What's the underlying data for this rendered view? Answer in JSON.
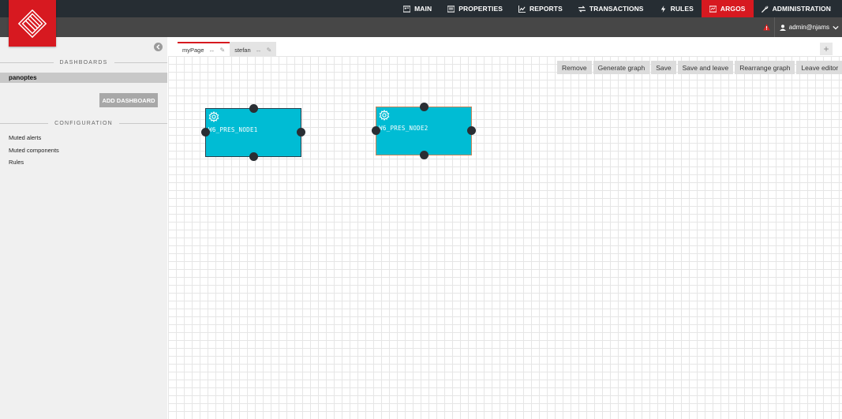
{
  "nav": {
    "items": [
      {
        "icon": "server-icon",
        "label": "MAIN"
      },
      {
        "icon": "list-icon",
        "label": "PROPERTIES"
      },
      {
        "icon": "chart-icon",
        "label": "REPORTS"
      },
      {
        "icon": "arrows-icon",
        "label": "TRANSACTIONS"
      },
      {
        "icon": "bolt-icon",
        "label": "RULES"
      },
      {
        "icon": "dashboard-icon",
        "label": "ARGOS"
      },
      {
        "icon": "wrench-icon",
        "label": "ADMINISTRATION"
      }
    ],
    "active": "ARGOS"
  },
  "user": {
    "name": "admin@njams"
  },
  "sidebar": {
    "dashboards_heading": "DASHBOARDS",
    "dashboards": [
      "panoptes"
    ],
    "add_dashboard_label": "ADD DASHBOARD",
    "configuration_heading": "CONFIGURATION",
    "configuration_items": [
      "Muted alerts",
      "Muted components",
      "Rules"
    ]
  },
  "tabs": [
    {
      "label": "myPage",
      "active": true
    },
    {
      "label": "stefan",
      "active": false
    }
  ],
  "toolbar": {
    "buttons": [
      "Remove",
      "Generate graph",
      "Save",
      "Save and leave",
      "Rearrange graph",
      "Leave editor"
    ]
  },
  "nodes": [
    {
      "label": "W6_PRES_NODE1"
    },
    {
      "label": "W6_PRES_NODE2"
    }
  ],
  "colors": {
    "brand_red": "#d71920",
    "node_fill": "#00bcd4",
    "topbar": "#262d33"
  }
}
